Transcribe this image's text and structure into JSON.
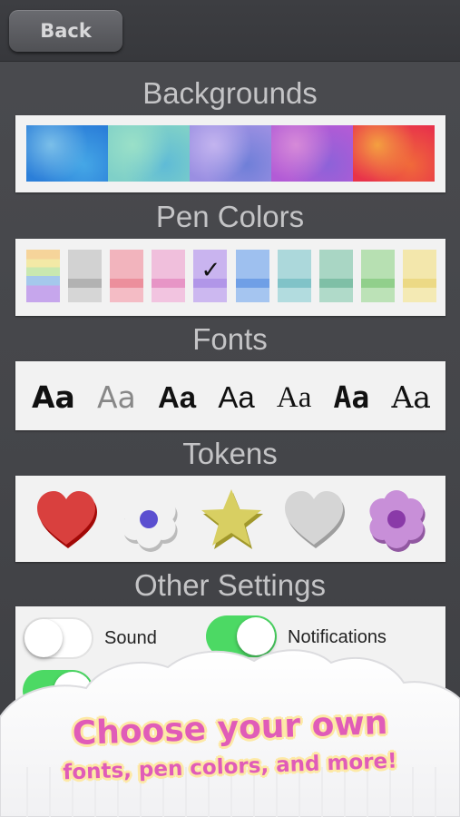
{
  "header": {
    "back_label": "Back"
  },
  "sections": {
    "backgrounds": "Backgrounds",
    "pen_colors": "Pen Colors",
    "fonts": "Fonts",
    "tokens": "Tokens",
    "other": "Other Settings"
  },
  "backgrounds": [
    {
      "name": "watercolor-blue",
      "colors": [
        "#2b7fd9",
        "#45a7e6",
        "#7bbfe9"
      ]
    },
    {
      "name": "watercolor-aqua",
      "colors": [
        "#7fd0c8",
        "#5fbbd6",
        "#9ae0c8"
      ]
    },
    {
      "name": "watercolor-violet",
      "colors": [
        "#9a8fe2",
        "#6f7fd8",
        "#c3b4ef"
      ]
    },
    {
      "name": "watercolor-purple",
      "colors": [
        "#b25bd6",
        "#8d62d8",
        "#d68ad8"
      ]
    },
    {
      "name": "watercolor-red-orange",
      "colors": [
        "#e8334a",
        "#f06a3a",
        "#f4a040"
      ]
    }
  ],
  "pen_colors": [
    {
      "name": "rainbow",
      "top": "#f4c98f",
      "band": "#a5c8ec",
      "bottom": "#c6a6ec"
    },
    {
      "name": "gray",
      "top": "#d2d2d2",
      "band": "#b2b2b2",
      "bottom": "#d6d6d6"
    },
    {
      "name": "pink",
      "top": "#f2b4bd",
      "band": "#ec8f9c",
      "bottom": "#f4bcc5"
    },
    {
      "name": "light-pink",
      "top": "#f0bfdc",
      "band": "#e795c6",
      "bottom": "#f2c4e0"
    },
    {
      "name": "lavender",
      "top": "#c9b4ef",
      "band": "#b196e8",
      "bottom": "#ccb8f0",
      "selected": true,
      "check": "✓"
    },
    {
      "name": "blue",
      "top": "#9ec0ef",
      "band": "#6f9fe6",
      "bottom": "#a5c5f0"
    },
    {
      "name": "teal",
      "top": "#acd8db",
      "band": "#80c3c8",
      "bottom": "#b2dcdf"
    },
    {
      "name": "green",
      "top": "#a9d6c4",
      "band": "#7fbfa6",
      "bottom": "#b0dac9"
    },
    {
      "name": "light-green",
      "top": "#b7e0b2",
      "band": "#91cf8b",
      "bottom": "#bce2b7"
    },
    {
      "name": "yellow",
      "top": "#f3e7ac",
      "band": "#ecd985",
      "bottom": "#f4eab4"
    }
  ],
  "fonts": [
    {
      "sample": "Aa",
      "family": "DejaVu Sans",
      "weight": "bold",
      "color": "#111"
    },
    {
      "sample": "Aa",
      "family": "DejaVu Sans",
      "weight": "normal",
      "color": "#888"
    },
    {
      "sample": "Aa",
      "family": "Liberation Sans",
      "weight": "bold",
      "color": "#111"
    },
    {
      "sample": "Aa",
      "family": "Liberation Sans",
      "weight": "normal",
      "color": "#111"
    },
    {
      "sample": "Aa",
      "family": "Liberation Serif",
      "weight": "normal",
      "color": "#111"
    },
    {
      "sample": "Aa",
      "family": "DejaVu Sans Mono",
      "weight": "bold",
      "color": "#111"
    },
    {
      "sample": "Aa",
      "family": "DejaVu Serif",
      "weight": "normal",
      "color": "#111"
    }
  ],
  "tokens": [
    {
      "name": "red-heart",
      "color": "#d9403e"
    },
    {
      "name": "white-flower",
      "color": "#f2f2f2",
      "center": "#5b4fd0"
    },
    {
      "name": "yellow-star",
      "color": "#d8cf62"
    },
    {
      "name": "gray-heart",
      "color": "#d5d5d5"
    },
    {
      "name": "purple-flower",
      "color": "#c88fd8",
      "center": "#8a3aa8"
    }
  ],
  "settings": {
    "sound": {
      "label": "Sound",
      "on": false
    },
    "notifications": {
      "label": "Notifications",
      "on": true
    },
    "third_toggle_on": true
  },
  "colors": {
    "toggle_on": "#4cd964",
    "toggle_off": "#ffffff",
    "promo_text": "#e05cb8"
  },
  "promo": {
    "line1": "Choose your own",
    "line2": "fonts, pen colors, and more!"
  }
}
